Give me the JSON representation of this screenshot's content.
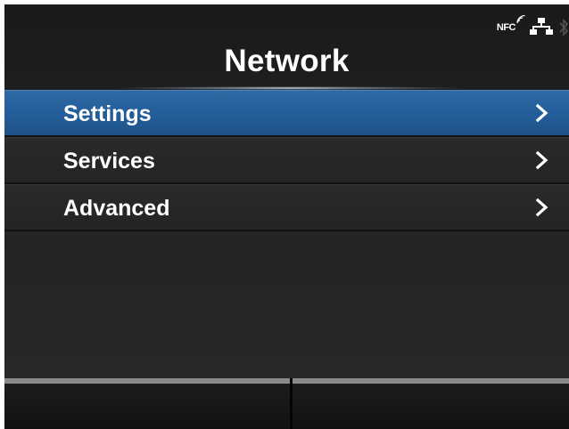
{
  "header": {
    "title": "Network",
    "status": {
      "nfc_label": "NFC",
      "icons": [
        "nfc-icon",
        "lan-icon",
        "bluetooth-icon"
      ]
    }
  },
  "menu": {
    "items": [
      {
        "label": "Settings",
        "selected": true
      },
      {
        "label": "Services",
        "selected": false
      },
      {
        "label": "Advanced",
        "selected": false
      }
    ]
  },
  "colors": {
    "selected_row": "#245e9a",
    "background": "#222222",
    "text": "#ffffff",
    "footer_bar": "#8a8a8a"
  }
}
